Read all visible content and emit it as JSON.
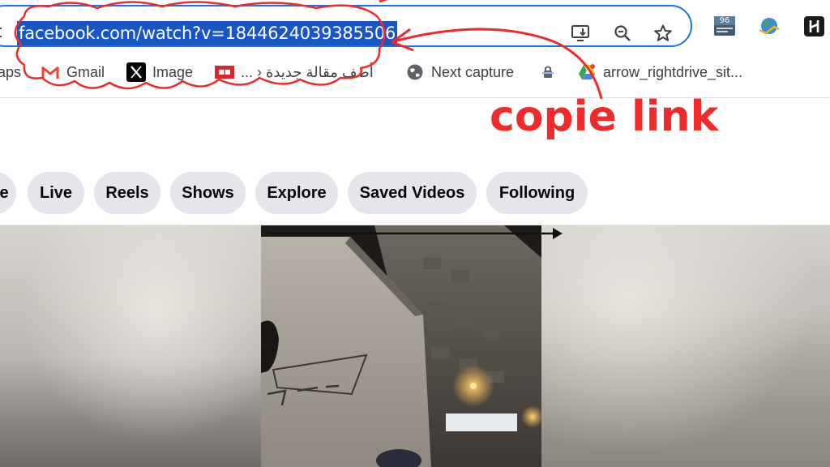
{
  "browser": {
    "url": "facebook.com/watch?v=1844624039385506",
    "extension_badge": "96"
  },
  "bookmarks": [
    {
      "label": "aps"
    },
    {
      "label": "Gmail"
    },
    {
      "label": "Image"
    },
    {
      "label": "أضف مقالة جديدة ‹ ..."
    },
    {
      "label": "Next capture"
    },
    {
      "label": ""
    },
    {
      "label": "arrow_rightdrive_sit..."
    }
  ],
  "tabs": [
    {
      "label": "e"
    },
    {
      "label": "Live"
    },
    {
      "label": "Reels"
    },
    {
      "label": "Shows"
    },
    {
      "label": "Explore"
    },
    {
      "label": "Saved Videos"
    },
    {
      "label": "Following"
    }
  ],
  "annotation": {
    "text": "copie link",
    "color": "#ee2a2a"
  },
  "colors": {
    "omnibox_border": "#1a73e8",
    "url_highlight": "#1a55c4",
    "tab_bg": "#e4e6eb"
  }
}
